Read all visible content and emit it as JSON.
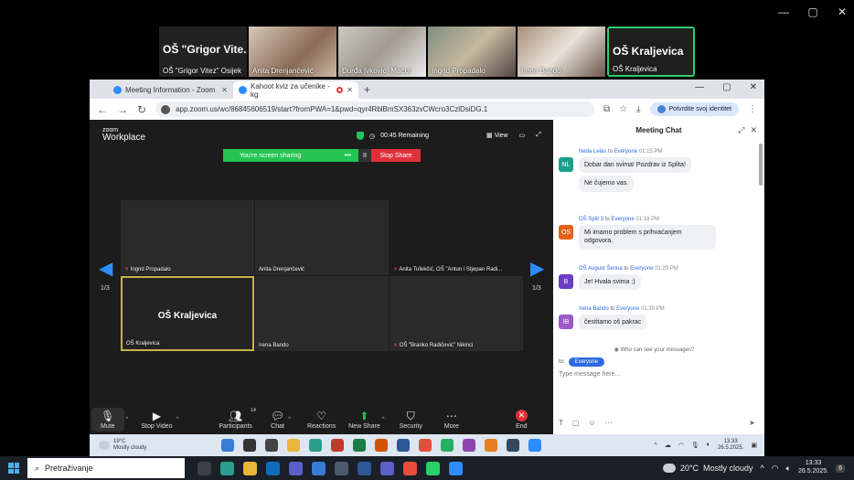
{
  "window_controls": {
    "minimize": "—",
    "maximize": "▢",
    "close": "✕"
  },
  "top_strip": [
    {
      "big": "OŠ \"Grigor Vite...",
      "label": "OŠ \"Grigor Vitez\" Osijek",
      "photo": false
    },
    {
      "big": "",
      "label": "Anita Drenjančević",
      "photo": "ph1"
    },
    {
      "big": "",
      "label": "Đurđa Ivković -Macut",
      "photo": "ph2"
    },
    {
      "big": "",
      "label": "Ingrid Propadalo",
      "photo": "ph3"
    },
    {
      "big": "",
      "label": "Irena Bando",
      "photo": "ph4"
    },
    {
      "big": "OŠ Kraljevica",
      "label": "OŠ Kraljevica",
      "photo": false,
      "active": true
    }
  ],
  "browser": {
    "tabs": [
      {
        "title": "Meeting Information - Zoom",
        "active": false
      },
      {
        "title": "Kahoot kviz za učenike - kg",
        "active": true
      }
    ],
    "new_tab": "+",
    "url": "app.zoom.us/wc/86845606519/start?fromPWA=1&pwd=qyr4RblBmSX363zvCWcro3CzlDsiDG.1",
    "verify_label": "Potvrdite svoj identitet"
  },
  "zoom": {
    "logo_top": "zoom",
    "logo_bottom": "Workplace",
    "timer": "00:45 Remaining",
    "view_label": "View",
    "share_status": "You're screen sharing",
    "share_more": "•••",
    "pause": "II",
    "stop_share": "Stop Share",
    "page_left": "1/3",
    "page_right": "1/3",
    "grid": [
      {
        "label": "Ingrid Propadalo",
        "muted": true,
        "photo": "ph3"
      },
      {
        "label": "Anita Drenjančević",
        "muted": false,
        "photo": "ph1"
      },
      {
        "label": "Anita Tufekčić, OŠ \"Antun i Stjepan Radi...",
        "muted": true,
        "photo": false
      },
      {
        "label": "OŠ Kraljevica",
        "big": "OŠ Kraljevica",
        "muted": false,
        "photo": false,
        "selected": true
      },
      {
        "label": "Irena Bando",
        "muted": false,
        "photo": "ph4"
      },
      {
        "label": "OŠ \"Branko Radičević\" Nikinci",
        "muted": true,
        "photo": "ph2"
      }
    ],
    "toolbar": {
      "mute": "Mute",
      "stop_video": "Stop Video",
      "participants": "Participants",
      "participants_count": "14",
      "chat": "Chat",
      "reactions": "Reactions",
      "new_share": "New Share",
      "security": "Security",
      "more": "More",
      "end": "End"
    }
  },
  "chat": {
    "title": "Meeting Chat",
    "messages": [
      {
        "sender": "Neda Lelas",
        "to": "to",
        "recipient": "Everyone",
        "time": "01:15 PM",
        "initials": "NL",
        "color": "#1aa08a",
        "texts": [
          "Dobar dan svima! Pozdrav iz Splita!",
          "Ne čujemo vas."
        ]
      },
      {
        "sender": "OŠ Split 3",
        "to": "to",
        "recipient": "Everyone",
        "time": "01:18 PM",
        "initials": "OS",
        "color": "#e2621b",
        "texts": [
          "Mi imamo problem s prihvaćanjem odgovora."
        ]
      },
      {
        "sender": "OŠ August Šenoa",
        "to": "to",
        "recipient": "Everyone",
        "time": "01:29 PM",
        "initials": "B",
        "color": "#6a3fc4",
        "texts": [
          "Je! Hvala svima :)"
        ]
      },
      {
        "sender": "Irena Bando",
        "to": "to",
        "recipient": "Everyone",
        "time": "01:30 PM",
        "initials": "IB",
        "color": "#9b59c9",
        "texts": [
          "čestitamo oš pakrac"
        ]
      }
    ],
    "who_can_see": "Who can see your messages?",
    "to_label": "to:",
    "recipient": "Everyone",
    "placeholder": "Type message here..."
  },
  "inner_taskbar": {
    "temp": "19°C",
    "weather": "Mostly cloudy",
    "time": "13:33",
    "date": "26.5.2025."
  },
  "taskbar": {
    "search": "Pretraživanje",
    "temp": "20°C",
    "weather": "Mostly cloudy",
    "time": "13:33",
    "date": "26.5.2025.",
    "notifications": "6"
  }
}
